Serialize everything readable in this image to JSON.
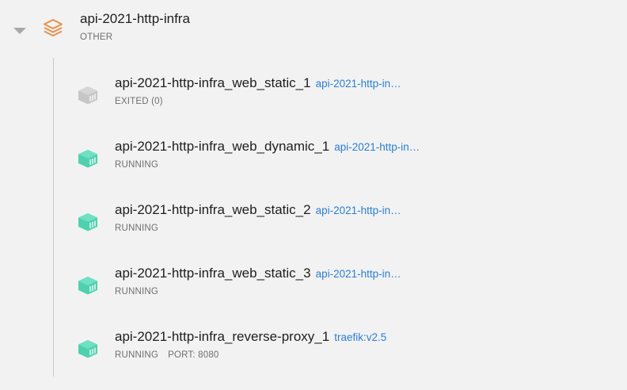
{
  "group": {
    "title": "api-2021-http-infra",
    "subtitle": "OTHER",
    "icon": "stack-layers-icon",
    "icon_color": "#e8914a"
  },
  "colors": {
    "running": "#4fd1b0",
    "exited": "#c6c6c6",
    "link": "#2a7fd4"
  },
  "containers": [
    {
      "name": "api-2021-http-infra_web_static_1",
      "image": "api-2021-http-in…",
      "status": "EXITED (0)",
      "port": "",
      "state": "exited"
    },
    {
      "name": "api-2021-http-infra_web_dynamic_1",
      "image": "api-2021-http-in…",
      "status": "RUNNING",
      "port": "",
      "state": "running"
    },
    {
      "name": "api-2021-http-infra_web_static_2",
      "image": "api-2021-http-in…",
      "status": "RUNNING",
      "port": "",
      "state": "running"
    },
    {
      "name": "api-2021-http-infra_web_static_3",
      "image": "api-2021-http-in…",
      "status": "RUNNING",
      "port": "",
      "state": "running"
    },
    {
      "name": "api-2021-http-infra_reverse-proxy_1",
      "image": "traefik:v2.5",
      "status": "RUNNING",
      "port": "PORT: 8080",
      "state": "running"
    }
  ]
}
